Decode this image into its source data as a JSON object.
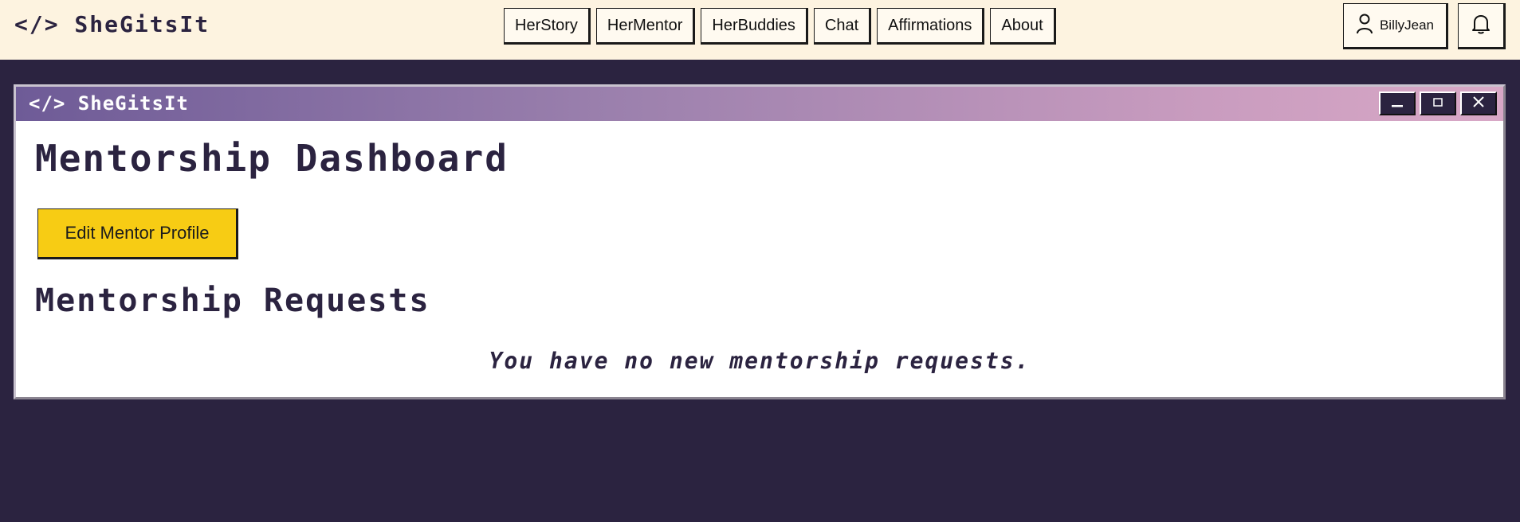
{
  "topbar": {
    "brand": "</> SheGitsIt",
    "nav": [
      "HerStory",
      "HerMentor",
      "HerBuddies",
      "Chat",
      "Affirmations",
      "About"
    ],
    "user": {
      "icon": "user-icon",
      "name": "BillyJean"
    },
    "notifications": {
      "icon": "bell-icon"
    }
  },
  "window": {
    "title": "</> SheGitsIt",
    "controls": [
      "minimize-icon",
      "maximize-icon",
      "close-icon"
    ],
    "dashboard_title": "Mentorship Dashboard",
    "edit_button": "Edit Mentor Profile",
    "requests_title": "Mentorship Requests",
    "empty_message": "You have no new mentorship requests."
  },
  "colors": {
    "background": "#2b2340",
    "topbar": "#fdf3e0",
    "accent_button": "#f7cc14",
    "titlebar_start": "#6e5b97",
    "titlebar_end": "#d8a8c6"
  }
}
